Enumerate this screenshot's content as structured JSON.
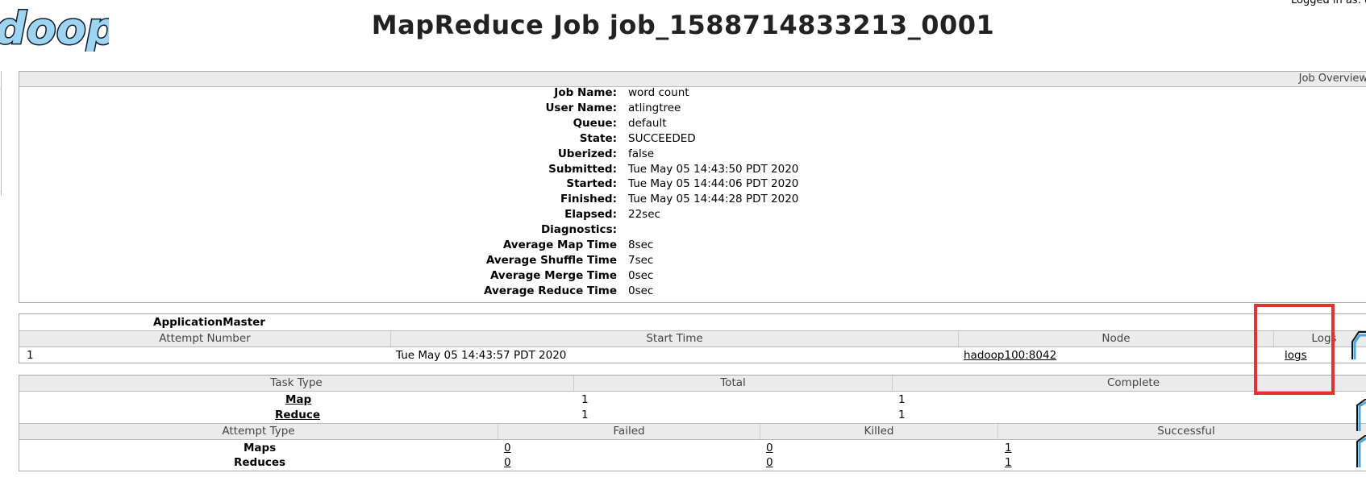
{
  "header": {
    "logo_text": "doop",
    "title": "MapReduce Job job_1588714833213_0001",
    "logged_in": "Logged in as: dr.who"
  },
  "overview": {
    "section_label": "Job Overview",
    "rows": [
      {
        "label": "Job Name:",
        "value": "word count"
      },
      {
        "label": "User Name:",
        "value": "atlingtree"
      },
      {
        "label": "Queue:",
        "value": "default"
      },
      {
        "label": "State:",
        "value": "SUCCEEDED"
      },
      {
        "label": "Uberized:",
        "value": "false"
      },
      {
        "label": "Submitted:",
        "value": "Tue May 05 14:43:50 PDT 2020"
      },
      {
        "label": "Started:",
        "value": "Tue May 05 14:44:06 PDT 2020"
      },
      {
        "label": "Finished:",
        "value": "Tue May 05 14:44:28 PDT 2020"
      },
      {
        "label": "Elapsed:",
        "value": "22sec"
      },
      {
        "label": "Diagnostics:",
        "value": ""
      },
      {
        "label": "Average Map Time",
        "value": "8sec"
      },
      {
        "label": "Average Shuffle Time",
        "value": "7sec"
      },
      {
        "label": "Average Merge Time",
        "value": "0sec"
      },
      {
        "label": "Average Reduce Time",
        "value": "0sec"
      }
    ]
  },
  "app_master": {
    "title": "ApplicationMaster",
    "headers": [
      "Attempt Number",
      "Start Time",
      "Node",
      "Logs"
    ],
    "row": {
      "attempt": "1",
      "start_time": "Tue May 05 14:43:57 PDT 2020",
      "node": "hadoop100:8042",
      "logs": "logs"
    }
  },
  "tasks": {
    "headers": [
      "Task Type",
      "Total",
      "Complete"
    ],
    "rows": [
      {
        "type": "Map",
        "total": "1",
        "complete": "1"
      },
      {
        "type": "Reduce",
        "total": "1",
        "complete": "1"
      }
    ]
  },
  "attempts": {
    "headers": [
      "Attempt Type",
      "Failed",
      "Killed",
      "Successful"
    ],
    "rows": [
      {
        "type": "Maps",
        "failed": "0",
        "killed": "0",
        "successful": "1"
      },
      {
        "type": "Reduces",
        "failed": "0",
        "killed": "0",
        "successful": "1"
      }
    ]
  },
  "colors": {
    "highlight": "#e8312f",
    "header_bg": "#ebebeb",
    "logo_fill": "#9fd4f0"
  }
}
